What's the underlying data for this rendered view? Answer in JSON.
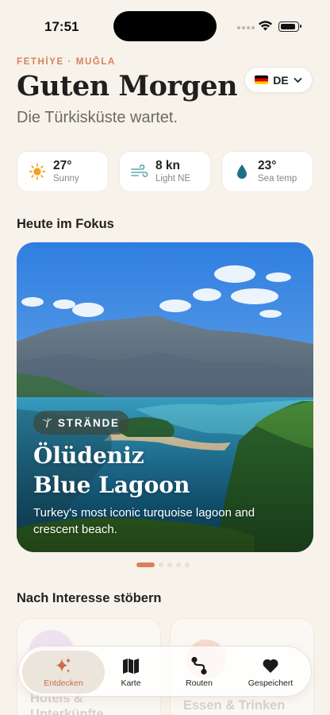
{
  "status_bar": {
    "time": "17:51"
  },
  "header": {
    "location": "FETHİYE · MUĞLA",
    "greeting": "Guten Morgen",
    "subtitle": "Die Türkisküste wartet.",
    "language_code": "DE"
  },
  "weather": [
    {
      "value": "27°",
      "label": "Sunny",
      "icon": "sun-icon"
    },
    {
      "value": "8 kn",
      "label": "Light NE",
      "icon": "wind-icon"
    },
    {
      "value": "23°",
      "label": "Sea temp",
      "icon": "water-drop-icon"
    }
  ],
  "featured": {
    "section_title": "Heute im Fokus",
    "tag": "STRÄNDE",
    "title": "Ölüdeniz Blue Lagoon",
    "description": "Turkey's most iconic turquoise lagoon and crescent beach.",
    "page_count": 5,
    "active_page": 1
  },
  "interests": {
    "section_title": "Nach Interesse stöbern",
    "items": [
      {
        "label": "Hotels & Unterkünfte"
      },
      {
        "label": "Essen & Trinken"
      }
    ]
  },
  "tabbar": {
    "items": [
      {
        "label": "Entdecken",
        "icon": "sparkle-icon",
        "active": true
      },
      {
        "label": "Karte",
        "icon": "map-icon",
        "active": false
      },
      {
        "label": "Routen",
        "icon": "route-icon",
        "active": false
      },
      {
        "label": "Gespeichert",
        "icon": "heart-icon",
        "active": false
      }
    ]
  },
  "colors": {
    "accent": "#d97f5d",
    "background": "#f8f3ea"
  }
}
